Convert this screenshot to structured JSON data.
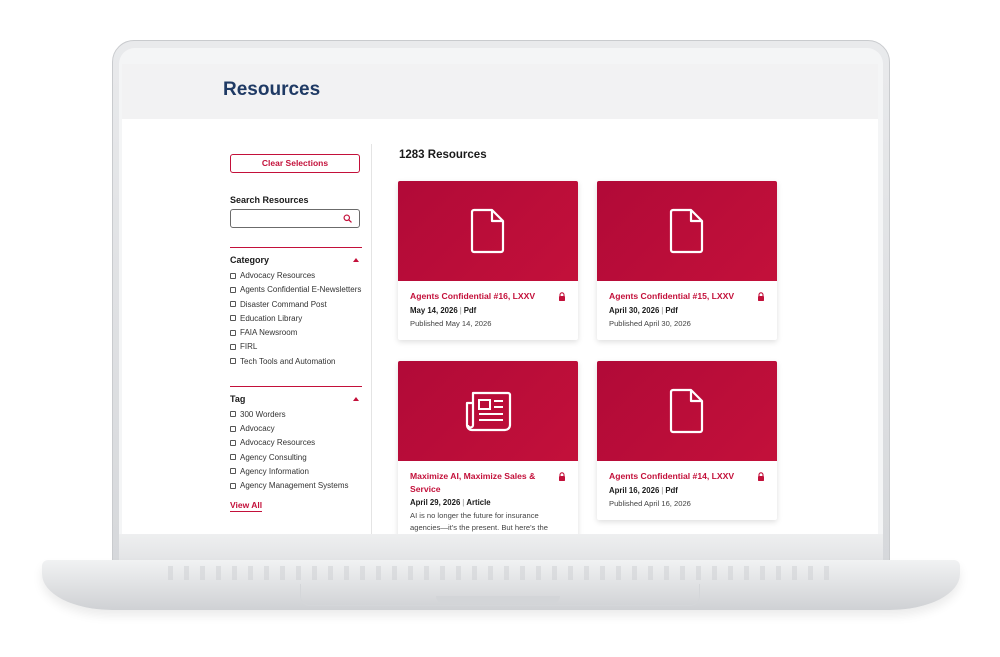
{
  "page": {
    "title": "Resources"
  },
  "sidebar": {
    "clear_label": "Clear Selections",
    "search_label": "Search Resources",
    "search_value": "",
    "category": {
      "title": "Category",
      "items": [
        "Advocacy Resources",
        "Agents Confidential E-Newsletters",
        "Disaster Command Post",
        "Education Library",
        "FAIA Newsroom",
        "FIRL",
        "Tech Tools and Automation"
      ]
    },
    "tag": {
      "title": "Tag",
      "items": [
        "300 Worders",
        "Advocacy",
        "Advocacy Resources",
        "Agency Consulting",
        "Agency Information",
        "Agency Management Systems"
      ],
      "view_all": "View All"
    }
  },
  "results": {
    "count_label": "1283 Resources",
    "cards": [
      {
        "icon": "document-icon",
        "title": "Agents Confidential #16, LXXV",
        "date": "May 14, 2026",
        "type": "Pdf",
        "desc": "Published May 14, 2026"
      },
      {
        "icon": "document-icon",
        "title": "Agents Confidential #15, LXXV",
        "date": "April 30, 2026",
        "type": "Pdf",
        "desc": "Published April 30, 2026"
      },
      {
        "icon": "newspaper-icon",
        "title": "Maximize AI, Maximize Sales & Service",
        "date": "April 29, 2026",
        "type": "Article",
        "desc": "AI is no longer the future for insurance agencies—it's the present. But here's the"
      },
      {
        "icon": "document-icon",
        "title": "Agents Confidential #14, LXXV",
        "date": "April 16, 2026",
        "type": "Pdf",
        "desc": "Published April 16, 2026"
      }
    ]
  },
  "colors": {
    "brand": "#c3103a",
    "title": "#1f3a64",
    "header_bg": "#f2f2f3"
  }
}
